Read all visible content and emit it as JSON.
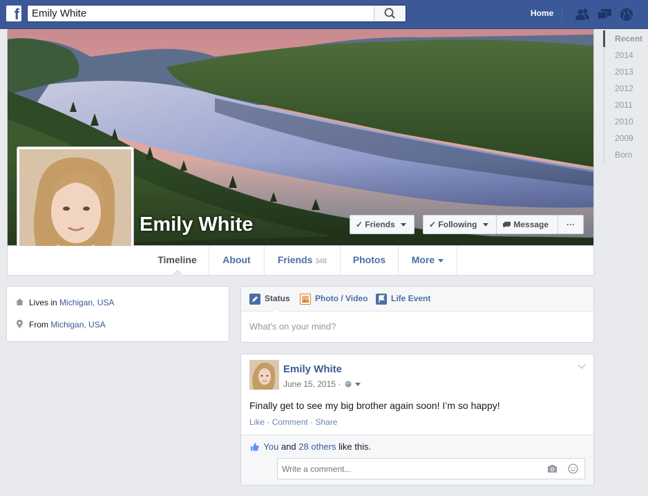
{
  "header": {
    "search_value": "Emily White",
    "home_label": "Home",
    "icons": [
      "facebook-logo-icon",
      "search-icon",
      "friend-requests-icon",
      "messages-icon",
      "notifications-globe-icon"
    ]
  },
  "year_nav": [
    "Recent",
    "2014",
    "2013",
    "2012",
    "2011",
    "2010",
    "2009",
    "Born"
  ],
  "profile": {
    "name": "Emily White",
    "buttons": {
      "friends": "Friends",
      "following": "Following",
      "message": "Message",
      "more": "···"
    }
  },
  "tabs": {
    "timeline": "Timeline",
    "about": "About",
    "friends": "Friends",
    "friends_count": "348",
    "photos": "Photos",
    "more": "More"
  },
  "about": {
    "lives_prefix": "Lives in",
    "lives_place": "Michigan, USA",
    "from_prefix": "From",
    "from_place": "Michigan, USA"
  },
  "composer": {
    "status": "Status",
    "photo_video": "Photo / Video",
    "life_event": "Life Event",
    "placeholder": "What's on your mind?"
  },
  "post": {
    "author": "Emily White",
    "date": "June 15, 2015 ·",
    "text": "Finally get to see my big brother again soon! I’m so happy!",
    "like": "Like",
    "comment": "Comment",
    "share": "Share",
    "sep": " · ",
    "likes_you": "You",
    "likes_and": "and",
    "likes_others": "28 others",
    "likes_suffix": "like this.",
    "comment_placeholder": "Write a comment..."
  },
  "colors": {
    "brand": "#3b5998",
    "link": "#4b6ea4",
    "page_bg": "#e9eaed"
  }
}
